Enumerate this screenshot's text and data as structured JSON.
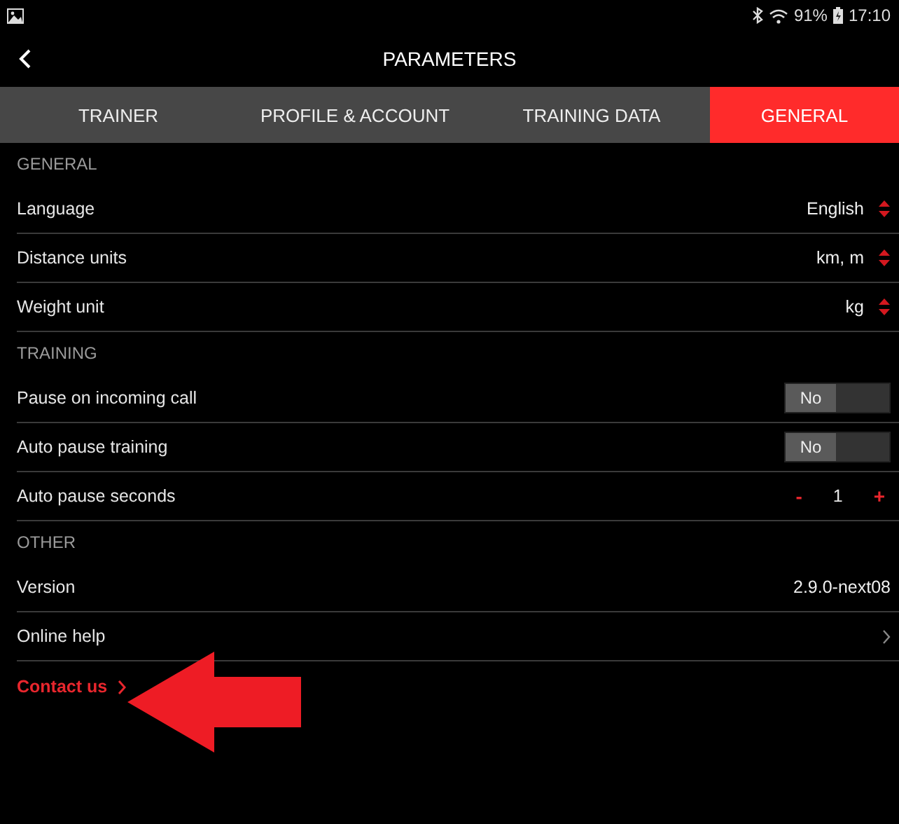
{
  "status_bar": {
    "battery": "91%",
    "time": "17:10"
  },
  "header": {
    "title": "PARAMETERS"
  },
  "tabs": [
    {
      "label": "TRAINER",
      "selected": false
    },
    {
      "label": "PROFILE & ACCOUNT",
      "selected": false
    },
    {
      "label": "TRAINING DATA",
      "selected": false
    },
    {
      "label": "GENERAL",
      "selected": true
    }
  ],
  "sections": [
    {
      "title": "GENERAL",
      "rows": [
        {
          "kind": "select",
          "label": "Language",
          "value": "English"
        },
        {
          "kind": "select",
          "label": "Distance units",
          "value": "km, m"
        },
        {
          "kind": "select",
          "label": "Weight unit",
          "value": "kg"
        }
      ]
    },
    {
      "title": "TRAINING",
      "rows": [
        {
          "kind": "toggle",
          "label": "Pause on incoming call",
          "value": "No",
          "on": false
        },
        {
          "kind": "toggle",
          "label": "Auto pause training",
          "value": "No",
          "on": false
        },
        {
          "kind": "stepper",
          "label": "Auto pause seconds",
          "value": "1",
          "minus": "-",
          "plus": "+"
        }
      ]
    },
    {
      "title": "OTHER",
      "rows": [
        {
          "kind": "value",
          "label": "Version",
          "value": "2.9.0-next08"
        },
        {
          "kind": "link",
          "label": "Online help"
        }
      ]
    }
  ],
  "contact_link": {
    "label": "Contact us"
  },
  "annotation": {
    "kind": "arrow",
    "color": "#ee1c25"
  }
}
